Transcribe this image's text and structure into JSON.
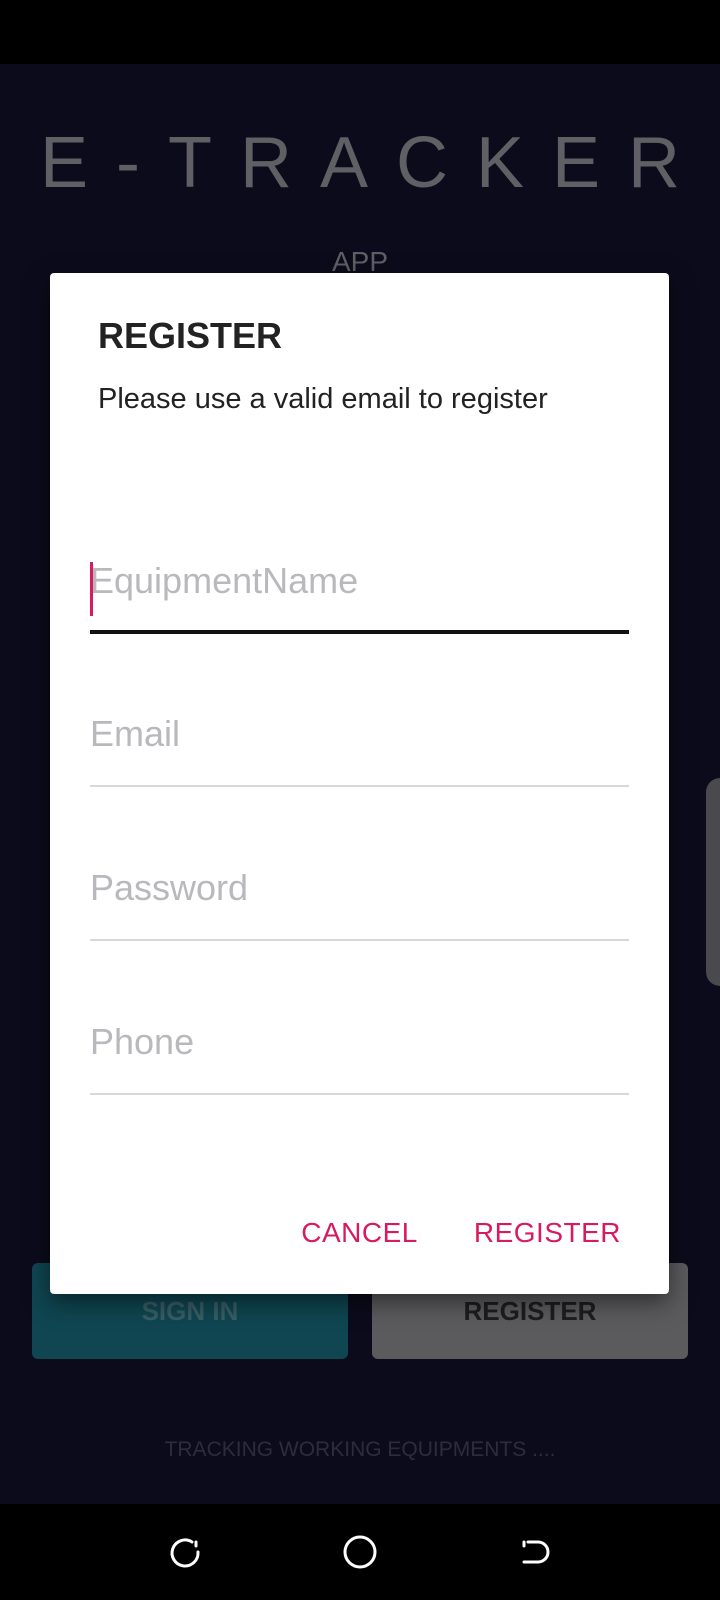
{
  "background": {
    "app_title": "E-TRACKER",
    "app_subtitle": "APP",
    "sign_in_label": "SIGN IN",
    "register_label": "REGISTER",
    "tagline": "TRACKING WORKING EQUIPMENTS ...."
  },
  "dialog": {
    "title": "REGISTER",
    "message": "Please use a valid email to register",
    "fields": {
      "equipment_name": {
        "placeholder": "EquipmentName",
        "value": ""
      },
      "email": {
        "placeholder": "Email",
        "value": ""
      },
      "password": {
        "placeholder": "Password",
        "value": ""
      },
      "phone": {
        "placeholder": "Phone",
        "value": ""
      }
    },
    "cancel_label": "CANCEL",
    "register_label": "REGISTER"
  },
  "colors": {
    "accent": "#d81b60",
    "background": "#0b0b1c",
    "sign_in_button": "#0f4651",
    "register_button": "#5b5b5d"
  },
  "icons": {
    "nav_recents": "recents-icon",
    "nav_home": "home-icon",
    "nav_back": "back-icon"
  }
}
